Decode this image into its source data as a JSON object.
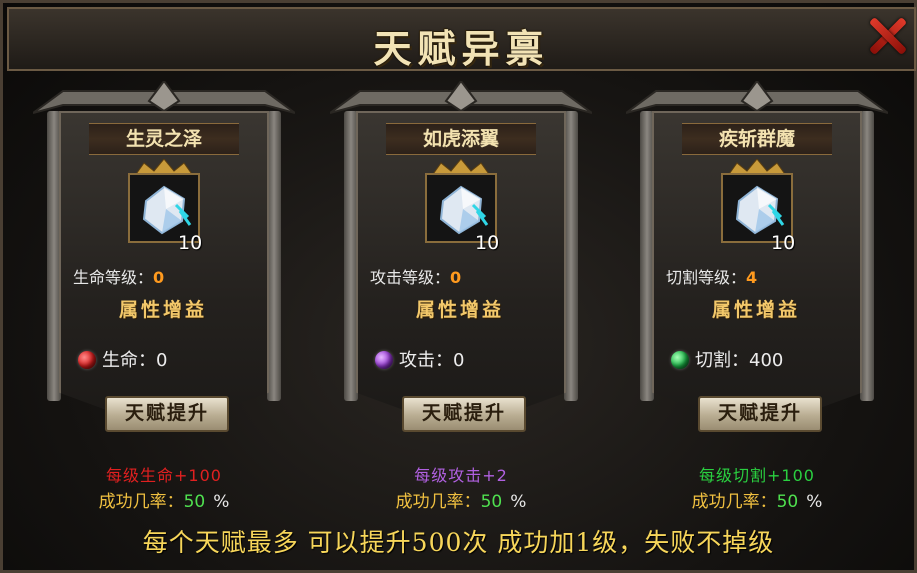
{
  "window": {
    "title": "天赋异禀",
    "close_icon": "close-x-icon"
  },
  "talents": [
    {
      "name": "生灵之泽",
      "gem_count": "10",
      "level_label": "生命等级：",
      "level_value": "0",
      "bonus_title": "属性增益",
      "stat_label": "生命：",
      "stat_value": "0",
      "stat_color": "#d91e1e",
      "upgrade_label": "天赋提升",
      "per_level_text": "每级生命+100",
      "per_level_color": "#e02020",
      "success_label": "成功几率：",
      "success_value": "50",
      "percent_sign": "%"
    },
    {
      "name": "如虎添翼",
      "gem_count": "10",
      "level_label": "攻击等级：",
      "level_value": "0",
      "bonus_title": "属性增益",
      "stat_label": "攻击：",
      "stat_value": "0",
      "stat_color": "#9a3cd8",
      "upgrade_label": "天赋提升",
      "per_level_text": "每级攻击+2",
      "per_level_color": "#b060e0",
      "success_label": "成功几率：",
      "success_value": "50",
      "percent_sign": "%"
    },
    {
      "name": "疾斩群魔",
      "gem_count": "10",
      "level_label": "切割等级：",
      "level_value": "4",
      "bonus_title": "属性增益",
      "stat_label": "切割：",
      "stat_value": "400",
      "stat_color": "#1eb84a",
      "upgrade_label": "天赋提升",
      "per_level_text": "每级切割+100",
      "per_level_color": "#2ad040",
      "success_label": "成功几率：",
      "success_value": "50",
      "percent_sign": "%"
    }
  ],
  "footer": {
    "note": "每个天赋最多 可以提升500次 成功加1级，失败不掉级"
  }
}
